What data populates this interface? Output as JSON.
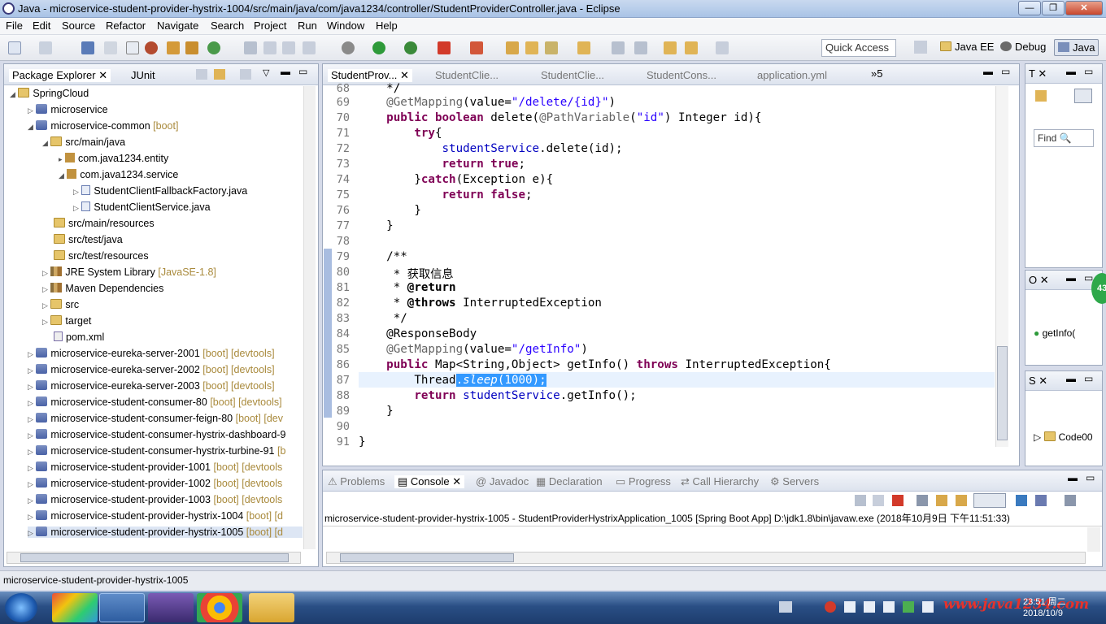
{
  "window": {
    "title": "Java - microservice-student-provider-hystrix-1004/src/main/java/com/java1234/controller/StudentProviderController.java - Eclipse"
  },
  "menu": [
    "File",
    "Edit",
    "Source",
    "Refactor",
    "Navigate",
    "Search",
    "Project",
    "Run",
    "Window",
    "Help"
  ],
  "toolbar": {
    "quick_access": "Quick Access",
    "perspectives": [
      "Java EE",
      "Debug",
      "Java"
    ]
  },
  "package_explorer": {
    "tabs": [
      "Package Explorer",
      "JUnit"
    ],
    "items": [
      {
        "label": "SpringCloud",
        "extra": ""
      },
      {
        "label": "microservice",
        "extra": ""
      },
      {
        "label": "microservice-common",
        "extra": "[boot]"
      },
      {
        "label": "src/main/java",
        "extra": ""
      },
      {
        "label": "com.java1234.entity",
        "extra": ""
      },
      {
        "label": "com.java1234.service",
        "extra": ""
      },
      {
        "label": "StudentClientFallbackFactory.java",
        "extra": ""
      },
      {
        "label": "StudentClientService.java",
        "extra": ""
      },
      {
        "label": "src/main/resources",
        "extra": ""
      },
      {
        "label": "src/test/java",
        "extra": ""
      },
      {
        "label": "src/test/resources",
        "extra": ""
      },
      {
        "label": "JRE System Library",
        "extra": "[JavaSE-1.8]"
      },
      {
        "label": "Maven Dependencies",
        "extra": ""
      },
      {
        "label": "src",
        "extra": ""
      },
      {
        "label": "target",
        "extra": ""
      },
      {
        "label": "pom.xml",
        "extra": ""
      },
      {
        "label": "microservice-eureka-server-2001",
        "extra": "[boot] [devtools]"
      },
      {
        "label": "microservice-eureka-server-2002",
        "extra": "[boot] [devtools]"
      },
      {
        "label": "microservice-eureka-server-2003",
        "extra": "[boot] [devtools]"
      },
      {
        "label": "microservice-student-consumer-80",
        "extra": "[boot] [devtools]"
      },
      {
        "label": "microservice-student-consumer-feign-80",
        "extra": "[boot] [dev"
      },
      {
        "label": "microservice-student-consumer-hystrix-dashboard-9",
        "extra": ""
      },
      {
        "label": "microservice-student-consumer-hystrix-turbine-91",
        "extra": "[b"
      },
      {
        "label": "microservice-student-provider-1001",
        "extra": "[boot] [devtools"
      },
      {
        "label": "microservice-student-provider-1002",
        "extra": "[boot] [devtools"
      },
      {
        "label": "microservice-student-provider-1003",
        "extra": "[boot] [devtools"
      },
      {
        "label": "microservice-student-provider-hystrix-1004",
        "extra": "[boot] [d"
      },
      {
        "label": "microservice-student-provider-hystrix-1005",
        "extra": "[boot] [d"
      }
    ]
  },
  "editor": {
    "tabs": [
      "StudentProv...",
      "StudentClie...",
      "StudentClie...",
      "StudentCons...",
      "application.yml",
      "»5"
    ],
    "line_numbers": [
      "68",
      "69",
      "70",
      "71",
      "72",
      "73",
      "74",
      "75",
      "76",
      "77",
      "78",
      "79",
      "80",
      "81",
      "82",
      "83",
      "84",
      "85",
      "86",
      "87",
      "88",
      "89",
      "90",
      "91"
    ]
  },
  "right_panels": {
    "find_label": "Find",
    "outline_item": "getInfo(",
    "code_item": "Code00",
    "badge": "43"
  },
  "bottom": {
    "tabs": [
      "Problems",
      "Console",
      "Javadoc",
      "Declaration",
      "Progress",
      "Call Hierarchy",
      "Servers"
    ],
    "console_line": "microservice-student-provider-hystrix-1005 - StudentProviderHystrixApplication_1005 [Spring Boot App] D:\\jdk1.8\\bin\\javaw.exe (2018年10月9日 下午11:51:33)"
  },
  "status_bar": {
    "text": "microservice-student-provider-hystrix-1005"
  },
  "taskbar": {
    "time": "23:51 周二",
    "date": "2018/10/9",
    "watermark": "www.java1234.com"
  }
}
